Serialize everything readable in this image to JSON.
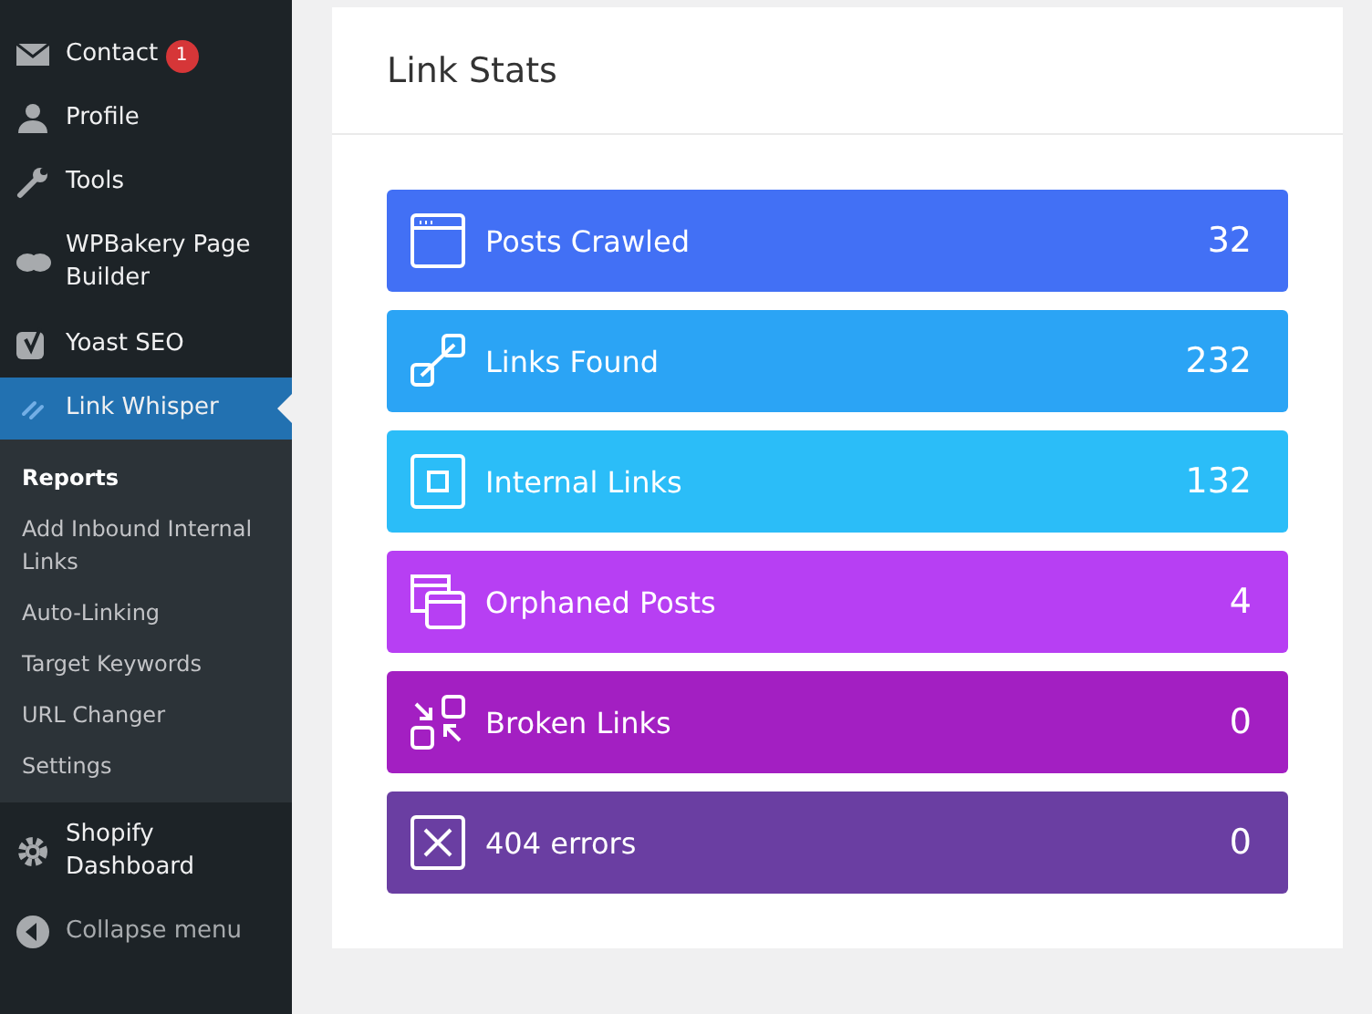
{
  "sidebar": {
    "items": [
      {
        "label": "Contact",
        "badge": "1",
        "selected": false
      },
      {
        "label": "Profile",
        "selected": false
      },
      {
        "label": "Tools",
        "selected": false
      },
      {
        "label": "WPBakery Page Builder",
        "selected": false
      },
      {
        "label": "Yoast SEO",
        "selected": false
      },
      {
        "label": "Link Whisper",
        "selected": true,
        "children": [
          {
            "label": "Reports",
            "selected": true
          },
          {
            "label": "Add Inbound Internal Links",
            "selected": false
          },
          {
            "label": "Auto-Linking",
            "selected": false
          },
          {
            "label": "Target Keywords",
            "selected": false
          },
          {
            "label": "URL Changer",
            "selected": false
          },
          {
            "label": "Settings",
            "selected": false
          }
        ]
      },
      {
        "label": "Shopify Dashboard",
        "selected": false
      }
    ],
    "collapse": "Collapse menu"
  },
  "card": {
    "title": "Link Stats",
    "stats": [
      {
        "label": "Posts Crawled",
        "value": "32",
        "color": "#4270f5"
      },
      {
        "label": "Links Found",
        "value": "232",
        "color": "#2ba4f5"
      },
      {
        "label": "Internal Links",
        "value": "132",
        "color": "#2bbdf8"
      },
      {
        "label": "Orphaned Posts",
        "value": "4",
        "color": "#b73ff3"
      },
      {
        "label": "Broken Links",
        "value": "0",
        "color": "#a31fc2"
      },
      {
        "label": "404 errors",
        "value": "0",
        "color": "#6a3ea2"
      }
    ]
  }
}
